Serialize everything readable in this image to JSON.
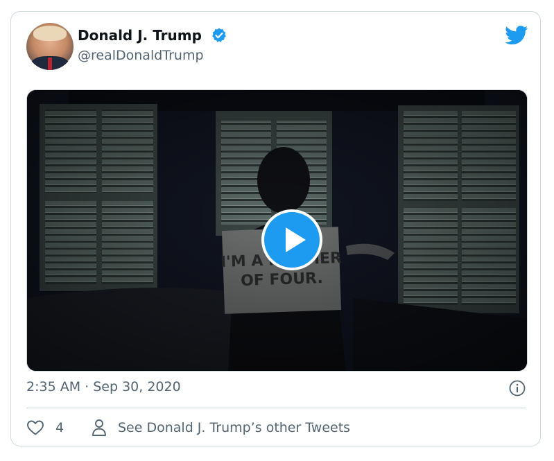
{
  "tweet": {
    "author_name": "Donald J. Trump",
    "author_handle": "@realDonaldTrump",
    "verified": true,
    "timestamp": "2:35 AM · Sep 30, 2020",
    "video_sign_text": "I'M A MOTHER OF FOUR.",
    "like_count": "4",
    "other_tweets_label": "See Donald J. Trump’s other Tweets"
  },
  "icons": {
    "brand": "twitter-bird-icon",
    "verified": "verified-badge-icon",
    "play": "play-icon",
    "info": "info-icon",
    "like": "heart-icon",
    "profile": "person-icon"
  },
  "colors": {
    "accent": "#1d9bf0",
    "text_primary": "#0f1419",
    "text_secondary": "#536471",
    "border": "#cfd9de"
  }
}
